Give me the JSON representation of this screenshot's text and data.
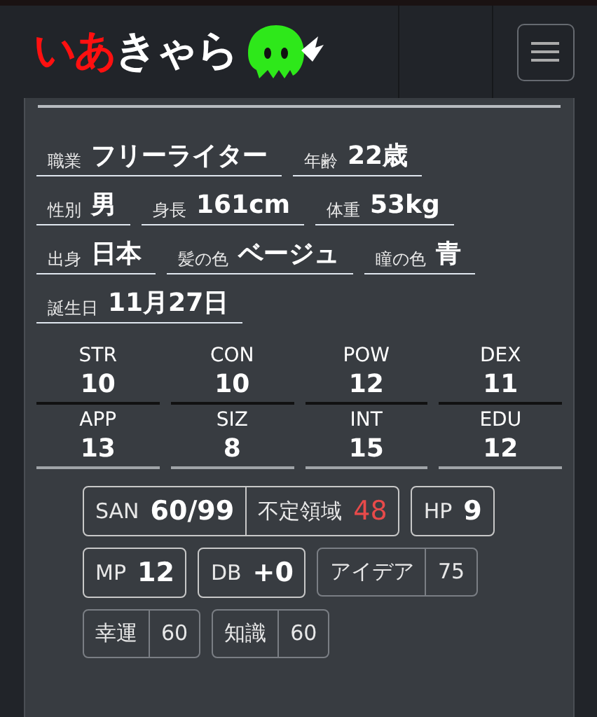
{
  "logo": {
    "red_text": "いあ",
    "white_text": "きゃら"
  },
  "profile_rows": [
    [
      {
        "label": "職業",
        "value": "フリーライター"
      },
      {
        "label": "年齢",
        "value": "22歳"
      }
    ],
    [
      {
        "label": "性別",
        "value": "男"
      },
      {
        "label": "身長",
        "value": "161cm"
      },
      {
        "label": "体重",
        "value": "53kg"
      }
    ],
    [
      {
        "label": "出身",
        "value": "日本"
      },
      {
        "label": "髪の色",
        "value": "ベージュ"
      },
      {
        "label": "瞳の色",
        "value": "青"
      }
    ],
    [
      {
        "label": "誕生日",
        "value": "11月27日"
      }
    ]
  ],
  "stats": [
    {
      "label": "STR",
      "value": "10"
    },
    {
      "label": "CON",
      "value": "10"
    },
    {
      "label": "POW",
      "value": "12"
    },
    {
      "label": "DEX",
      "value": "11"
    },
    {
      "label": "APP",
      "value": "13"
    },
    {
      "label": "SIZ",
      "value": "8"
    },
    {
      "label": "INT",
      "value": "15"
    },
    {
      "label": "EDU",
      "value": "12"
    }
  ],
  "badges": [
    {
      "kind": "san",
      "label": "SAN",
      "value": "60/99",
      "sub_label": "不定領域",
      "sub_value": "48"
    },
    {
      "kind": "stat",
      "label": "HP",
      "value": "9"
    },
    {
      "kind": "stat",
      "label": "MP",
      "value": "12"
    },
    {
      "kind": "stat",
      "label": "DB",
      "value": "+0"
    },
    {
      "kind": "split",
      "label": "アイデア",
      "value": "75"
    },
    {
      "kind": "split",
      "label": "幸運",
      "value": "60"
    },
    {
      "kind": "split",
      "label": "知識",
      "value": "60"
    }
  ]
}
